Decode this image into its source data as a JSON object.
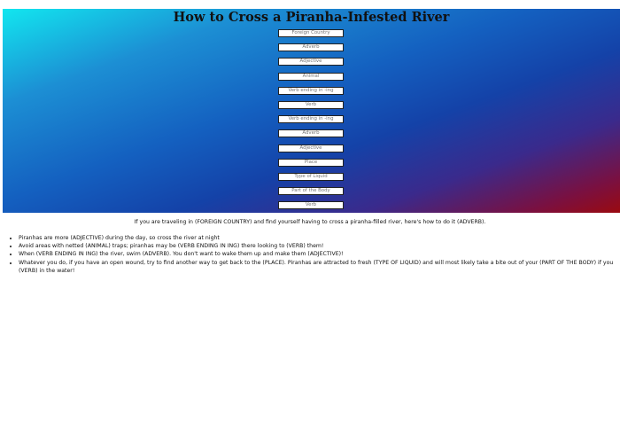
{
  "page": {
    "title": "How to Cross a Piranha-Infested River"
  },
  "form": {
    "fields": [
      {
        "placeholder": "Foreign Country"
      },
      {
        "placeholder": "Adverb"
      },
      {
        "placeholder": "Adjective"
      },
      {
        "placeholder": "Animal"
      },
      {
        "placeholder": "Verb ending in -ing"
      },
      {
        "placeholder": "Verb"
      },
      {
        "placeholder": "Verb ending in -ing"
      },
      {
        "placeholder": "Adverb"
      },
      {
        "placeholder": "Adjective"
      },
      {
        "placeholder": "Place"
      },
      {
        "placeholder": "Type of Liquid"
      },
      {
        "placeholder": "Part of the Body"
      },
      {
        "placeholder": "Verb"
      }
    ]
  },
  "story": {
    "intro": "If you are traveling in (FOREIGN COUNTRY) and find yourself having to cross a piranha-filled river, here's how to do it (ADVERB).",
    "items": [
      "Piranhas are more (ADJECTIVE) during the day, so cross the river at night",
      "Avoid areas with netted (ANIMAL) traps; piranhas may be (VERB ENDING IN ING) there looking to (VERB) them!",
      "When (VERB ENDING IN ING) the river, swim (ADVERB). You don't want to wake them up and make them (ADJECTIVE)!",
      "Whatever you do, if you have an open wound, try to find another way to get back to the (PLACE). Piranhas are attracted to fresh (TYPE OF LIQUID) and will most likely take a bite out of your (PART OF THE BODY) if you (VERB) in the water!"
    ]
  },
  "colors": {
    "gradient_top_left": "#12e6ef",
    "gradient_mid": "#1442a8",
    "gradient_bottom_right": "#9a0a10"
  }
}
